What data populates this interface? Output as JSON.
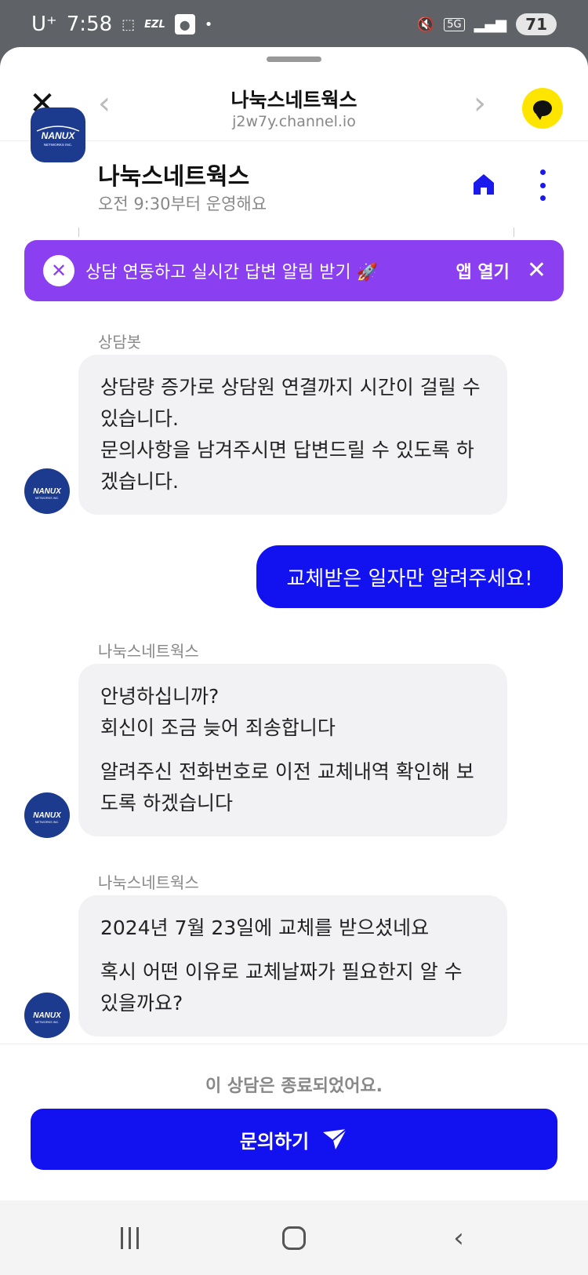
{
  "status_bar": {
    "carrier": "U⁺",
    "time": "7:58",
    "ezl_label": "EZL",
    "network_label": "5G",
    "battery": "71"
  },
  "browser": {
    "title": "나눅스네트웍스",
    "url": "j2w7y.channel.io"
  },
  "channel": {
    "name": "나눅스네트웍스",
    "hours": "오전 9:30부터 운영해요",
    "logo_text": "NANUX",
    "logo_subtext": "NETWORKS INC."
  },
  "promo": {
    "text": "상담 연동하고 실시간 답변 알림 받기 🚀",
    "open_label": "앱 열기"
  },
  "messages": [
    {
      "sender": "상담봇",
      "paragraphs": [
        "상담량 증가로 상담원 연결까지 시간이 걸릴 수 있습니다.\n문의사항을 남겨주시면 답변드릴 수 있도록 하겠습니다."
      ]
    },
    {
      "sender": "나눅스네트웍스",
      "paragraphs": [
        "안녕하십니까?\n회신이 조금 늦어 죄송합니다",
        "알려주신 전화번호로 이전 교체내역 확인해 보도록 하겠습니다"
      ]
    },
    {
      "sender": "나눅스네트웍스",
      "paragraphs": [
        "2024년 7월 23일에 교체를 받으셨네요",
        "혹시 어떤 이유로 교체날짜가 필요한지 알 수 있을까요?"
      ]
    }
  ],
  "outgoing": {
    "text": "교체받은 일자만 알려주세요!"
  },
  "footer": {
    "closed_notice": "이 상담은 종료되었어요.",
    "inquiry_label": "문의하기"
  },
  "colors": {
    "primary": "#1212f0",
    "promo": "#8a3ff0",
    "kakao": "#fee500",
    "logo_bg": "#1c3a8e"
  }
}
